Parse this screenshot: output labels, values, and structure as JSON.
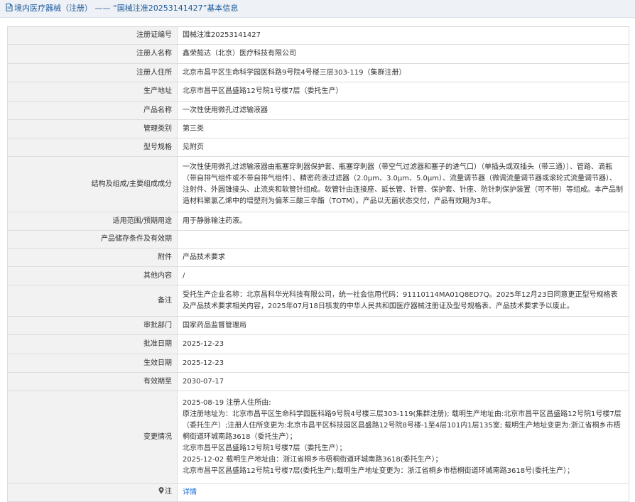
{
  "header": {
    "section": "境内医疗器械（注册）",
    "separator": "——",
    "subtitle": "“国械注准20253141427”基本信息"
  },
  "rows": [
    {
      "label": "注册证编号",
      "value": "国械注准20253141427"
    },
    {
      "label": "注册人名称",
      "value": "鑫荣懿达（北京）医疗科技有限公司"
    },
    {
      "label": "注册人住所",
      "value": "北京市昌平区生命科学园医科路9号院4号楼三层303-119（集群注册）"
    },
    {
      "label": "生产地址",
      "value": "北京市昌平区昌盛路12号院1号楼7层（委托生产）"
    },
    {
      "label": "产品名称",
      "value": "一次性使用微孔过滤输液器"
    },
    {
      "label": "管理类别",
      "value": "第三类"
    },
    {
      "label": "型号规格",
      "value": "见附页"
    },
    {
      "label": "结构及组成/主要组成成分",
      "value": "一次性使用微孔过滤输液器由瓶塞穿刺器保护套、瓶塞穿刺器（带空气过滤器和塞子的进气口）（单插头或双插头（带三通））、管路、滴瓶（带自排气组件或不带自排气组件）、精密药液过滤器（2.0μm、3.0μm、5.0μm）、流量调节器（微调流量调节器或滚轮式流量调节器）、注射件、外圆锥接头、止流夹和软管针组成。软管针由连接座、延长管、针管、保护套、针座、防针刺保护装置（可不带）等组成。本产品制造材料聚氯乙烯中的增塑剂为偏苯三酸三辛酯（TOTM）。产品以无菌状态交付，产品有效期为3年。"
    },
    {
      "label": "适用范围/预期用途",
      "value": "用于静脉输注药液。"
    },
    {
      "label": "产品储存条件及有效期",
      "value": ""
    },
    {
      "label": "附件",
      "value": "产品技术要求"
    },
    {
      "label": "其他内容",
      "value": "/"
    },
    {
      "label": "备注",
      "value": "受托生产企业名称：北京昌科华光科技有限公司，统一社会信用代码：91110114MA01Q8ED7Q。2025年12月23日同意更正型号规格表及产品技术要求相关内容，2025年07月18日核发的中华人民共和国医疗器械注册证及型号规格表、产品技术要求予以废止。"
    },
    {
      "label": "审批部门",
      "value": "国家药品监督管理局"
    },
    {
      "label": "批准日期",
      "value": "2025-12-23"
    },
    {
      "label": "生效日期",
      "value": "2025-12-23"
    },
    {
      "label": "有效期至",
      "value": "2030-07-17"
    }
  ],
  "changes": {
    "label": "变更情况",
    "lines": [
      "2025-08-19 注册人住所由:",
      "原注册地址为：北京市昌平区生命科学园医科路9号院4号楼三层303-119(集群注册); 载明生产地址由:北京市昌平区昌盛路12号院1号楼7层（委托生产）;注册人住所变更为:北京市昌平区科技园区昌盛路12号院8号楼-1至4层101内1层135室; 载明生产地址变更为:浙江省桐乡市梧桐街道环城南路3618（委托生产）；",
      "北京市昌平区昌盛路12号院1号楼7层（委托生产）；",
      "2025-12-02 载明生产地址由：浙江省桐乡市梧桐街道环城南路3618(委托生产）；",
      "北京市昌平区昌盛路12号院1号楼7层(委托生产);载明生产地址变更为：浙江省桐乡市梧桐街道环城南路3618号(委托生产）；"
    ]
  },
  "note": {
    "label": "注",
    "link_text": "详情",
    "icon": "pin-icon"
  },
  "colors": {
    "header_bg": "#eef1f5",
    "header_text": "#1d5a9c",
    "label_bg": "#f2f2f2",
    "border": "#dcdcdc",
    "link": "#1a6ed8"
  }
}
